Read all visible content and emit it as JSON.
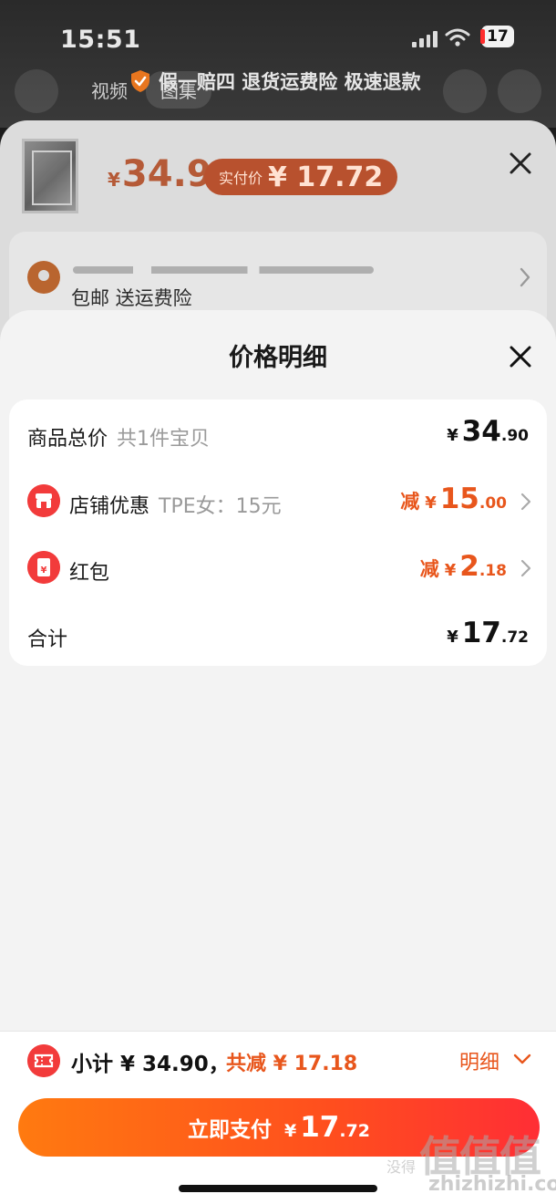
{
  "status_bar": {
    "time": "15:51",
    "battery": "17"
  },
  "background": {
    "tab_video": "视频",
    "tab_image": "图集",
    "guarantee_text": "假一赔四 退货运费险 极速退款"
  },
  "product_sheet": {
    "price_currency": "¥",
    "price": "34.9",
    "paid_label": "实付价",
    "paid_value": "¥ 17.72",
    "shipping_text": "包邮  送运费险"
  },
  "price_detail": {
    "title": "价格明细",
    "rows": [
      {
        "label": "商品总价",
        "sub": "共1件宝贝",
        "prefix": "",
        "currency": "¥",
        "int": "34",
        "dec": ".90"
      },
      {
        "label": "店铺优惠",
        "sub": "TPE女：15元",
        "prefix": "减",
        "currency": "¥",
        "int": "15",
        "dec": ".00"
      },
      {
        "label": "红包",
        "sub": "",
        "prefix": "减",
        "currency": "¥",
        "int": "2",
        "dec": ".18"
      },
      {
        "label": "合计",
        "sub": "",
        "prefix": "",
        "currency": "¥",
        "int": "17",
        "dec": ".72"
      }
    ]
  },
  "bottom_bar": {
    "subtotal": "小计 ¥ 34.90，",
    "discount_total": "共减 ¥ 17.18",
    "detail_link": "明细",
    "pay_label": "立即支付",
    "pay_currency": "¥",
    "pay_int": "17",
    "pay_dec": ".72"
  },
  "watermark": {
    "logo": "值值值",
    "site": "zhizhizhi.com",
    "small": "没得"
  },
  "colors": {
    "accent": "#e8561c",
    "pay_gradient_start": "#ff7a10",
    "pay_gradient_end": "#ff2e35",
    "icon_red": "#f23b3b"
  },
  "icons": [
    "shield-check-icon",
    "close-icon",
    "location-pin-icon",
    "chevron-right-icon",
    "shop-icon",
    "red-packet-icon",
    "ticket-icon",
    "chevron-down-icon"
  ]
}
